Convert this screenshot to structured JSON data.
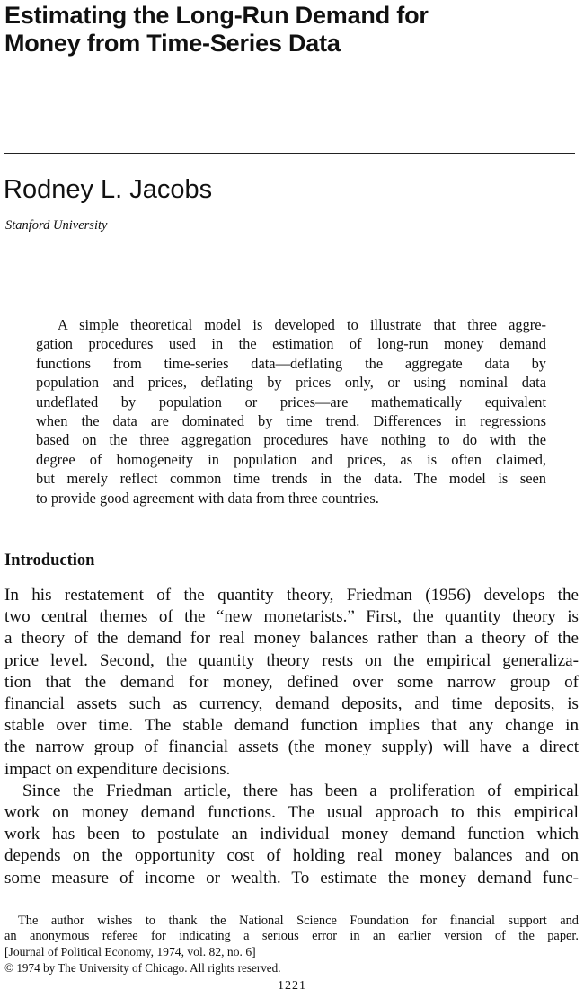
{
  "title_lines": [
    "Estimating the Long-Run Demand for",
    "Money from Time-Series Data"
  ],
  "author": "Rodney L. Jacobs",
  "affiliation": "Stanford University",
  "abstract_lines": [
    "A simple theoretical model is developed to illustrate that three aggre-",
    "gation procedures used in the estimation of long-run money demand",
    "functions from time-series data—deflating the aggregate data by",
    "population and prices, deflating by prices only, or using nominal data",
    "undeflated by population or prices—are mathematically equivalent",
    "when the data are dominated by time trend. Differences in regressions",
    "based on the three aggregation procedures have nothing to do with the",
    "degree of homogeneity in population and prices, as is often claimed,",
    "but merely reflect common time trends in the data. The model is seen",
    "to provide good agreement with data from three countries."
  ],
  "section_heading": "Introduction",
  "body_lines": [
    "In his restatement of the quantity theory, Friedman (1956) develops the",
    "two central themes of the “new monetarists.” First, the quantity theory is",
    "a theory of the demand for real money balances rather than a theory of the",
    "price level. Second, the quantity theory rests on the empirical generaliza-",
    "tion that the demand for money, defined over some narrow group of",
    "financial assets such as currency, demand deposits, and time deposits, is",
    "stable over time. The stable demand function implies that any change in",
    "the narrow group of financial assets (the money supply) will have a direct",
    "impact on expenditure decisions.",
    "Since the Friedman article, there has been a proliferation of empirical",
    "work on money demand functions. The usual approach to this empirical",
    "work has been to postulate an individual money demand function which",
    "depends on the opportunity cost of holding real money balances and on",
    "some measure of income or wealth. To estimate the money demand func-"
  ],
  "footnote_lines": [
    "The author wishes to thank the National Science Foundation for financial support and",
    "an anonymous referee for indicating a serious error in an earlier version of the paper.",
    "[Journal of Political Economy, 1974, vol. 82, no. 6]",
    "© 1974 by The University of Chicago. All rights reserved."
  ],
  "page_number": "1221"
}
